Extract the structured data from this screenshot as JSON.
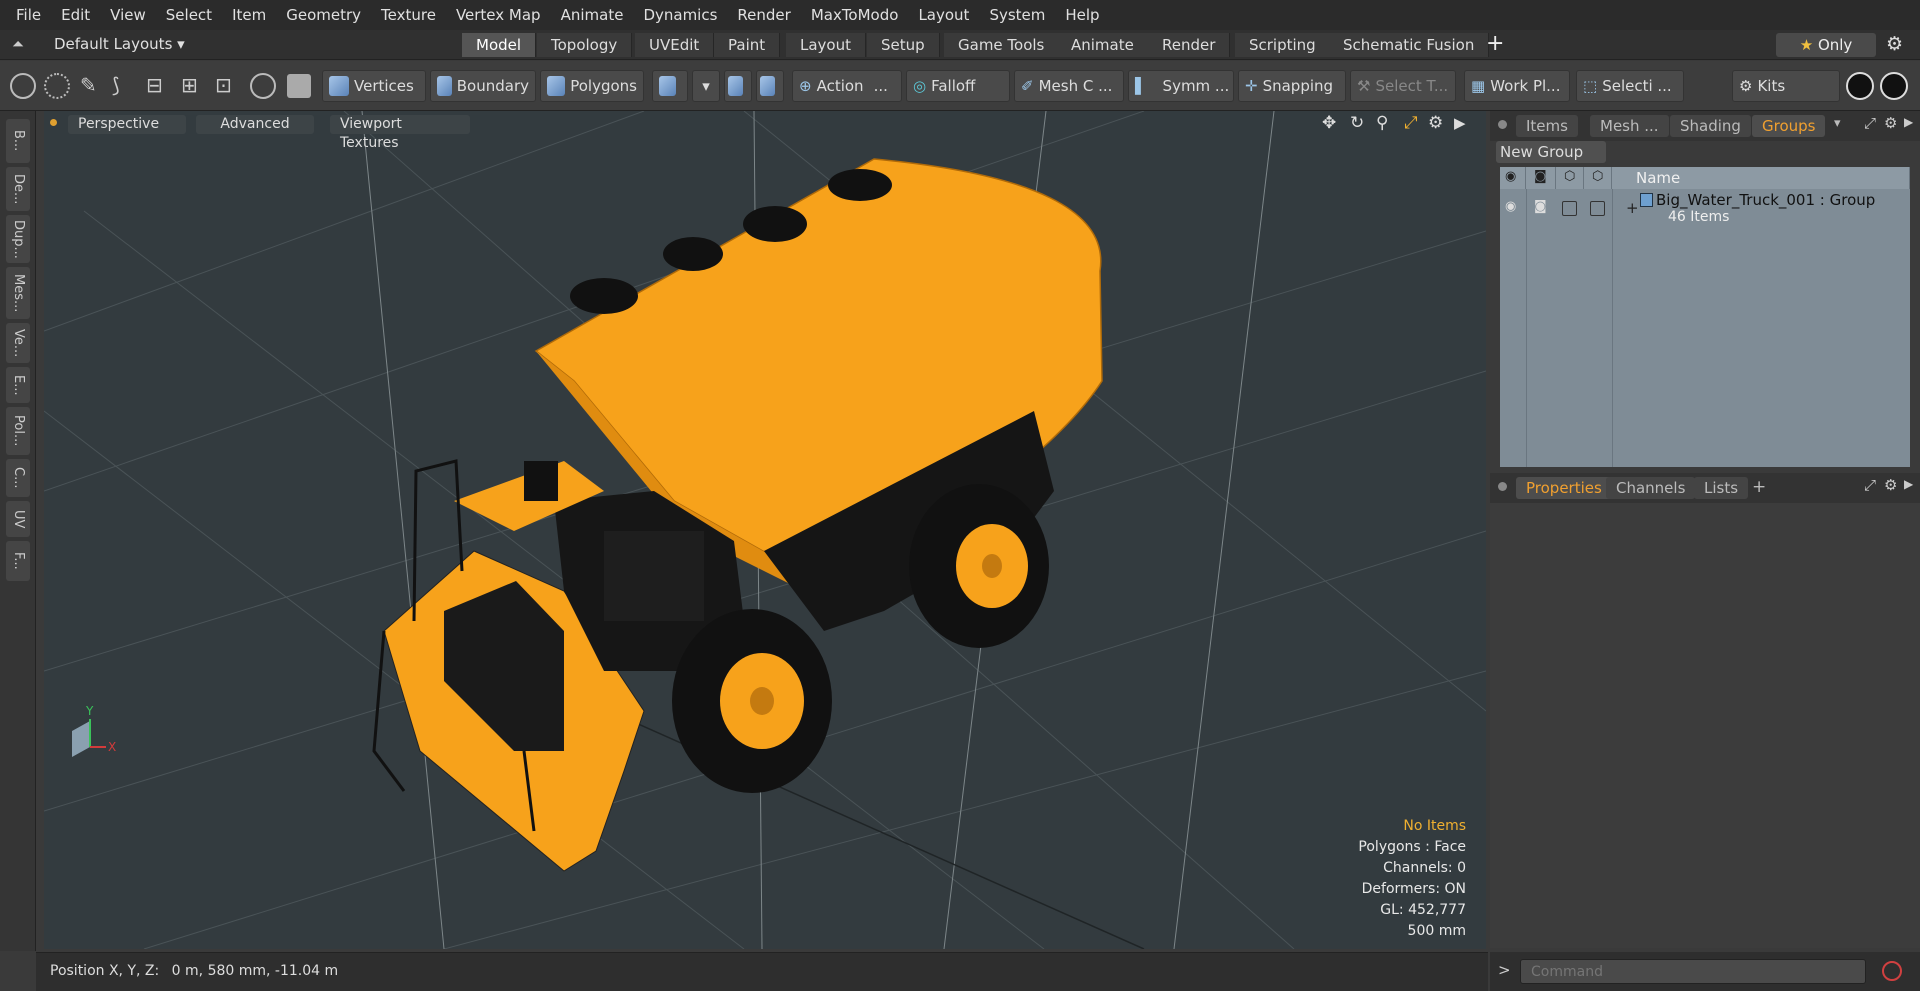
{
  "menu": [
    "File",
    "Edit",
    "View",
    "Select",
    "Item",
    "Geometry",
    "Texture",
    "Vertex Map",
    "Animate",
    "Dynamics",
    "Render",
    "MaxToModo",
    "Layout",
    "System",
    "Help"
  ],
  "layout_bar": {
    "default_layouts": "Default Layouts",
    "tabs": [
      "Model",
      "Topology",
      "UVEdit",
      "Paint",
      "Layout",
      "Setup",
      "Game Tools",
      "Animate",
      "Render",
      "Scripting",
      "Schematic Fusion"
    ],
    "active_tab": "Model",
    "add": "+",
    "only": "Only",
    "star": "★"
  },
  "toolbar": {
    "vertices": "Vertices",
    "boundary": "Boundary",
    "polygons": "Polygons",
    "action": "Action",
    "falloff": "Falloff",
    "mesh_c": "Mesh C ...",
    "symm": "Symm ...",
    "snapping": "Snapping",
    "select_t": "Select T...",
    "work_pl": "Work Pl...",
    "selecti": "Selecti ...",
    "kits": "Kits",
    "dots": "..."
  },
  "left_tabs": [
    "B...",
    "De...",
    "Dup...",
    "Mes...",
    "Ve...",
    "E...",
    "Pol...",
    "C...",
    "UV",
    "F..."
  ],
  "viewport": {
    "perspective": "Perspective",
    "advanced": "Advanced",
    "viewport_textures": "Viewport Textures",
    "stats": {
      "no_items": "No Items",
      "polygons": "Polygons : Face",
      "channels": "Channels: 0",
      "deformers": "Deformers: ON",
      "gl": "GL: 452,777",
      "scale": "500 mm"
    },
    "axis_y": "Y",
    "axis_x": "X"
  },
  "status_bar": {
    "position_label": "Position X, Y, Z:",
    "position_value": "0 m, 580 mm, -11.04 m"
  },
  "right_panel": {
    "top_tabs": [
      "Items",
      "Mesh ...",
      "Shading",
      "Groups"
    ],
    "active_top_tab": "Groups",
    "new_group": "New Group",
    "name_header": "Name",
    "group": {
      "name": "Big_Water_Truck_001 : Group",
      "count": "46 Items",
      "expand": "+"
    },
    "bottom_tabs": [
      "Properties",
      "Channels",
      "Lists"
    ],
    "active_bottom_tab": "Properties",
    "bottom_add": "+",
    "command_placeholder": "Command",
    "prompt": ">"
  },
  "colors": {
    "accent": "#f0a030",
    "truck": "#f7a21b",
    "viewport_bg": "#333b3f"
  }
}
